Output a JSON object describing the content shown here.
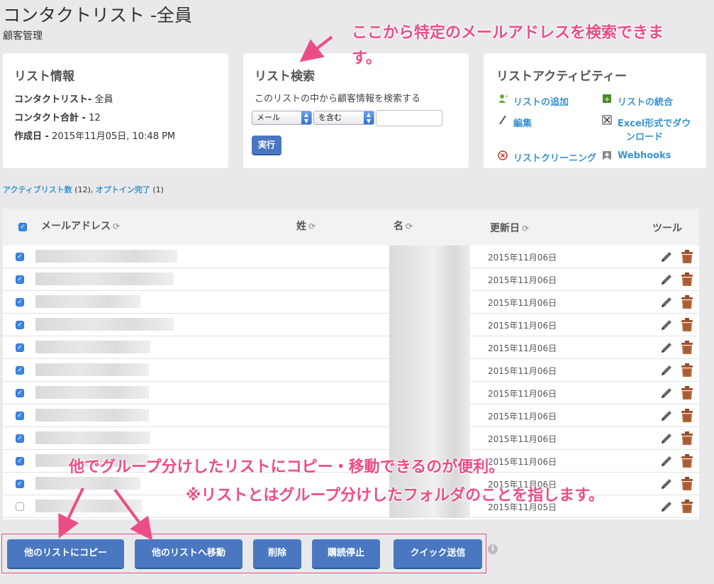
{
  "page": {
    "title": "コンタクトリスト -全員",
    "subtitle": "顧客管理"
  },
  "info_card": {
    "heading": "リスト情報",
    "list_label": "コンタクトリスト-",
    "list_value": "全員",
    "total_label": "コンタクト合計 -",
    "total_value": "12",
    "created_label": "作成日 -",
    "created_value": "2015年11月05日, 10:48 PM"
  },
  "search_card": {
    "heading": "リスト検索",
    "description": "このリストの中から顧客情報を検索する",
    "field_select": "メール",
    "operator_select": "を含む",
    "input_value": "",
    "exec_label": "実行"
  },
  "activity_card": {
    "heading": "リストアクティビティー",
    "add_list": "リストの追加",
    "merge_list": "リストの統合",
    "edit": "編集",
    "excel_line1": "Excel形式でダウ",
    "excel_line2": "ンロード",
    "cleaning": "リストクリーニング",
    "webhooks": "Webhooks"
  },
  "summary": {
    "active_label": "アクティブリスト数",
    "active_count": "(12),",
    "optin_label": "オプトイン完了",
    "optin_count": "(1)"
  },
  "table": {
    "headers": {
      "email": "メールアドレス",
      "last_name": "姓",
      "first_name": "名",
      "updated": "更新日",
      "tools": "ツール"
    },
    "sort_glyph": "⟳",
    "rows": [
      {
        "date": "2015年11月06日",
        "checked": true
      },
      {
        "date": "2015年11月06日",
        "checked": true
      },
      {
        "date": "2015年11月06日",
        "checked": true
      },
      {
        "date": "2015年11月06日",
        "checked": true
      },
      {
        "date": "2015年11月06日",
        "checked": true
      },
      {
        "date": "2015年11月06日",
        "checked": true
      },
      {
        "date": "2015年11月06日",
        "checked": true
      },
      {
        "date": "2015年11月06日",
        "checked": true
      },
      {
        "date": "2015年11月06日",
        "checked": true
      },
      {
        "date": "2015年11月06日",
        "checked": true
      },
      {
        "date": "2015年11月06日",
        "checked": true
      },
      {
        "date": "2015年11月05日",
        "checked": false
      }
    ]
  },
  "actions": {
    "copy": "他のリストにコピー",
    "move": "他のリストへ移動",
    "delete": "削除",
    "unsubscribe": "購読停止",
    "quick_send": "クイック送信",
    "info": "i"
  },
  "annotations": {
    "search_line1": "ここから特定のメールアドレスを検索できま",
    "search_line2": "す。",
    "copy_move": "他でグループ分けしたリストにコピー・移動できるのが便利。",
    "list_note": "※リストとはグループ分けしたフォルダのことを指します。"
  },
  "colors": {
    "accent": "#4a78c0",
    "link": "#3a93cf",
    "annotation": "#ec4d87"
  }
}
